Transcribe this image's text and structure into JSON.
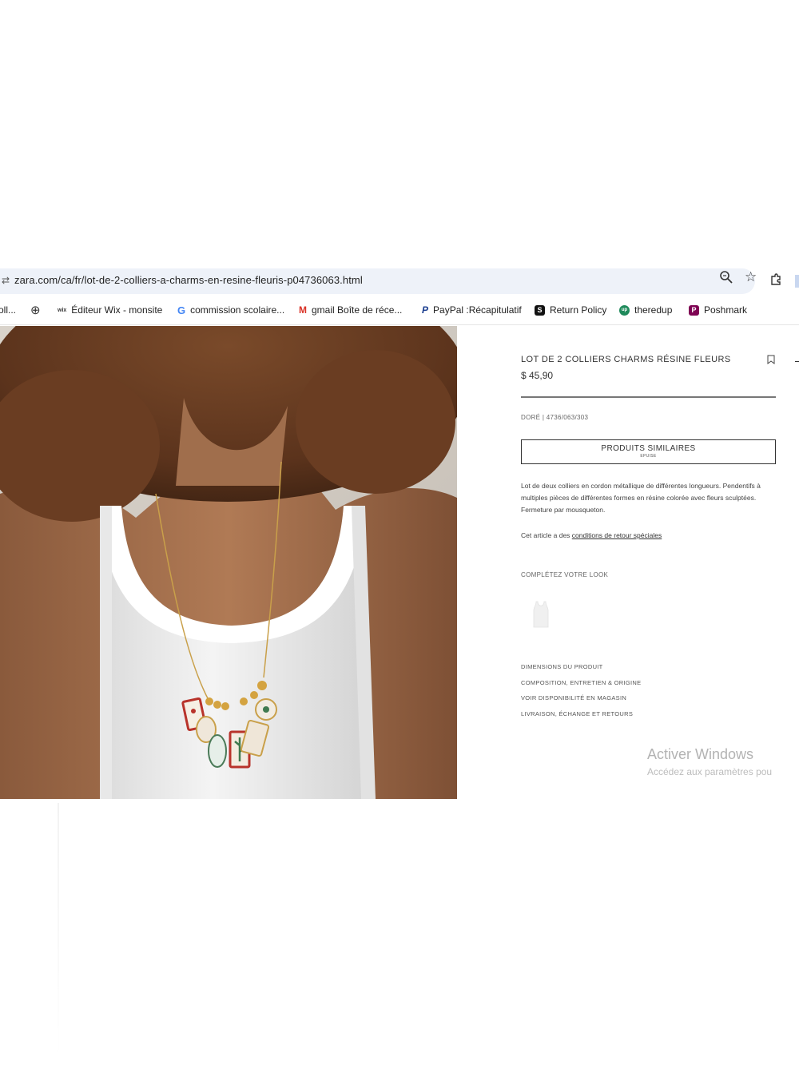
{
  "browser": {
    "url": "zara.com/ca/fr/lot-de-2-colliers-a-charms-en-resine-fleuris-p04736063.html",
    "site_icon_glyph": "⇄",
    "star_glyph": "☆",
    "bookmarks": [
      {
        "label": "oll...",
        "icon": "folder-icon"
      },
      {
        "label": "",
        "icon": "globe-icon",
        "glyph": "⊕"
      },
      {
        "label": "Éditeur Wix - monsite",
        "icon": "wix-icon",
        "glyph": "wix"
      },
      {
        "label": "commission scolaire...",
        "icon": "google-icon",
        "glyph": "G"
      },
      {
        "label": "gmail Boîte de réce...",
        "icon": "gmail-icon",
        "glyph": "M"
      },
      {
        "label": "PayPal :Récapitulatif",
        "icon": "paypal-icon",
        "glyph": "P"
      },
      {
        "label": "Return Policy",
        "icon": "s-icon",
        "glyph": "S"
      },
      {
        "label": "theredup",
        "icon": "thredup-icon",
        "glyph": "up"
      },
      {
        "label": "Poshmark",
        "icon": "poshmark-icon",
        "glyph": "P"
      }
    ]
  },
  "product": {
    "title": "LOT DE 2 COLLIERS CHARMS RÉSINE FLEURS",
    "price": "$ 45,90",
    "color_ref": "DORÉ | 4736/063/303",
    "similar_button": "PRODUITS SIMILAIRES",
    "similar_sub": "EPUISE",
    "description": "Lot de deux colliers en cordon métallique de différentes longueurs. Pendentifs à multiples pièces de différentes formes en résine colorée avec fleurs sculptées. Fermeture par mousqueton.",
    "return_prefix": "Cet article a des ",
    "return_link": "conditions de retour spéciales",
    "complete_look": "COMPLÉTEZ VOTRE LOOK",
    "links": [
      "DIMENSIONS DU PRODUIT",
      "COMPOSITION, ENTRETIEN & ORIGINE",
      "VOIR DISPONIBILITÉ EN MAGASIN",
      "LIVRAISON, ÉCHANGE ET RETOURS"
    ]
  },
  "watermark": {
    "title": "Activer Windows",
    "subtitle": "Accédez aux paramètres pou"
  },
  "colors": {
    "omnibox": "#eef2f9",
    "paypal": "#1a3d8f",
    "gmail": "#d93025",
    "poshmark": "#7f0353",
    "thredup": "#1f8a5b"
  }
}
